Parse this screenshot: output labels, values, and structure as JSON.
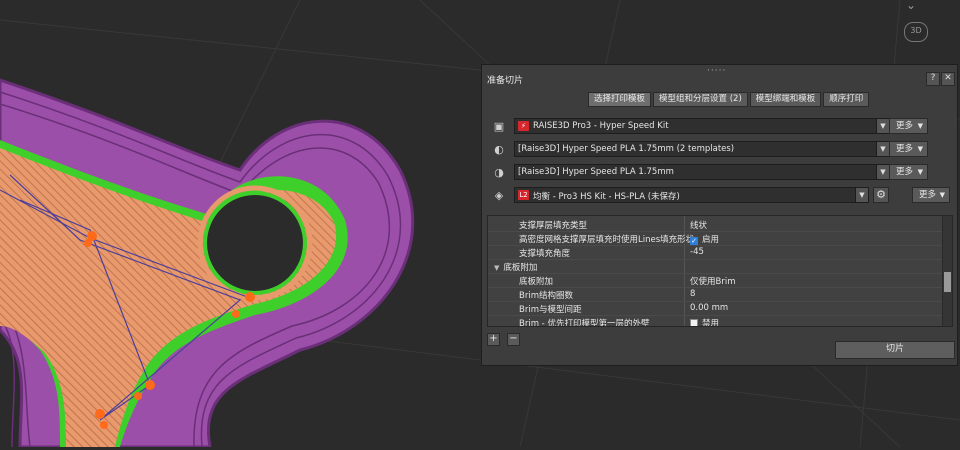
{
  "viewport": {
    "view_mode_label": "3D",
    "colors": {
      "background": "#2b2b2b",
      "outer_wall": "#9b4fa8",
      "inner_wall": "#3fcf2a",
      "infill": "#e89a6c",
      "travel": "#4a3f9c",
      "retract_marker": "#ff6a1a"
    }
  },
  "dialog": {
    "title": "准备切片",
    "help_label": "?",
    "close_label": "✕",
    "tabs": [
      "选择打印模板",
      "模型组和分层设置 (2)",
      "模型绑端和模板",
      "顺序打印"
    ],
    "active_tab": 0,
    "rows": [
      {
        "icon": "printer-icon",
        "badge": "⚡",
        "value": "RAISE3D Pro3 - Hyper Speed Kit",
        "more": "更多"
      },
      {
        "icon": "filament-left-icon",
        "badge": "",
        "value": "[Raise3D] Hyper Speed PLA 1.75mm (2 templates)",
        "more": "更多"
      },
      {
        "icon": "filament-right-icon",
        "badge": "",
        "value": "[Raise3D] Hyper Speed PLA 1.75mm",
        "more": "更多"
      },
      {
        "icon": "layers-icon",
        "badge": "L2",
        "value": "均衡 - Pro3 HS Kit - HS-PLA (未保存)",
        "more": "更多"
      }
    ],
    "settings": [
      {
        "type": "row",
        "name": "支撑厚层填充类型",
        "value": "线状"
      },
      {
        "type": "row",
        "name": "高密度网格支撑厚层填充时使用Lines填充形状",
        "value": "启用",
        "checkbox": true
      },
      {
        "type": "row",
        "name": "支撑填充角度",
        "value": "-45"
      },
      {
        "type": "category",
        "name": "底板附加"
      },
      {
        "type": "row",
        "name": "底板附加",
        "value": "仅使用Brim"
      },
      {
        "type": "row",
        "name": "Brim结构圈数",
        "value": "8"
      },
      {
        "type": "row",
        "name": "Brim与模型间距",
        "value": "0.00 mm"
      },
      {
        "type": "row",
        "name": "Brim - 优先打印模型第一层的外壁",
        "value": "禁用",
        "checkbox": false
      }
    ],
    "add_label": "+",
    "remove_label": "−",
    "slice_label": "切片"
  }
}
